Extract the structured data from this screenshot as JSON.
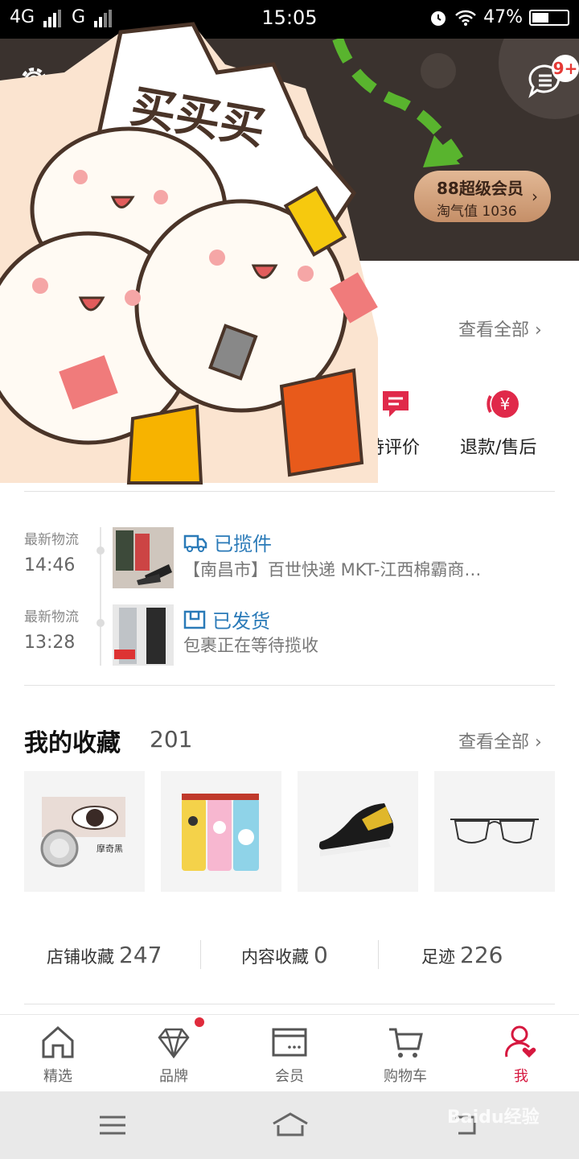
{
  "status_bar": {
    "network": "4G",
    "network2": "G",
    "time": "15:05",
    "battery": "47%"
  },
  "header": {
    "message_badge": "9+",
    "vip_title": "88超级会员",
    "vip_subtitle": "淘气值 1036",
    "banner_text": "买买买"
  },
  "orders": {
    "view_all": "查看全部",
    "items": [
      {
        "label": "待评价",
        "icon": "comment-icon"
      },
      {
        "label": "退款/售后",
        "icon": "refund-icon"
      }
    ],
    "partial_label": "待"
  },
  "logistics": [
    {
      "label": "最新物流",
      "time": "14:46",
      "status": "已揽件",
      "desc": "【南昌市】百世快递 MKT-江西棉霸商…"
    },
    {
      "label": "最新物流",
      "time": "13:28",
      "status": "已发货",
      "desc": "包裹正在等待揽收"
    }
  ],
  "favorites": {
    "title": "我的收藏",
    "count": "201",
    "view_all": "查看全部",
    "item1_text": "摩奇黑"
  },
  "stats": [
    {
      "label": "店铺收藏",
      "value": "247"
    },
    {
      "label": "内容收藏",
      "value": "0"
    },
    {
      "label": "足迹",
      "value": "226"
    }
  ],
  "tabs": [
    {
      "label": "精选"
    },
    {
      "label": "品牌"
    },
    {
      "label": "会员"
    },
    {
      "label": "购物车"
    },
    {
      "label": "我"
    }
  ],
  "watermark": "Baidu经验",
  "colors": {
    "accent": "#d6183f",
    "link": "#2a7ab8",
    "banner": "#3a322e",
    "vip": "#c58f68"
  }
}
